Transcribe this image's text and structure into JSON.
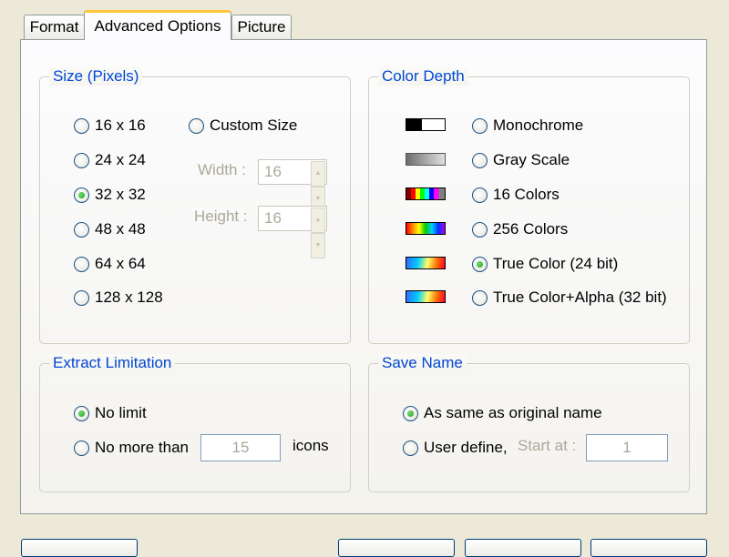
{
  "tabs": [
    {
      "label": "Format",
      "active": false
    },
    {
      "label": "Advanced Options",
      "active": true
    },
    {
      "label": "Picture",
      "active": false
    }
  ],
  "size_group": {
    "title": "Size (Pixels)",
    "options": [
      {
        "label": "16 x 16",
        "checked": false
      },
      {
        "label": "24 x 24",
        "checked": false
      },
      {
        "label": "32 x 32",
        "checked": true
      },
      {
        "label": "48 x 48",
        "checked": false
      },
      {
        "label": "64 x 64",
        "checked": false
      },
      {
        "label": "128 x 128",
        "checked": false
      }
    ],
    "custom": {
      "label": "Custom Size",
      "checked": false
    },
    "width": {
      "label": "Width :",
      "value": "16"
    },
    "height": {
      "label": "Height :",
      "value": "16"
    }
  },
  "color_group": {
    "title": "Color Depth",
    "options": [
      {
        "label": "Monochrome",
        "checked": false,
        "icon": "monochrome-swatch"
      },
      {
        "label": "Gray Scale",
        "checked": false,
        "icon": "grayscale-swatch"
      },
      {
        "label": "16 Colors",
        "checked": false,
        "icon": "16-colors-swatch"
      },
      {
        "label": "256 Colors",
        "checked": false,
        "icon": "256-colors-swatch"
      },
      {
        "label": "True Color (24 bit)",
        "checked": true,
        "icon": "true-color-swatch"
      },
      {
        "label": "True Color+Alpha (32 bit)",
        "checked": false,
        "icon": "true-color-alpha-swatch"
      }
    ]
  },
  "extract_group": {
    "title": "Extract Limitation",
    "no_limit": {
      "label": "No limit",
      "checked": true
    },
    "no_more_than": {
      "label": "No more than",
      "checked": false,
      "value": "15",
      "suffix": "icons"
    }
  },
  "save_group": {
    "title": "Save Name",
    "same": {
      "label": "As same as original name",
      "checked": true
    },
    "user": {
      "label": "User define,",
      "checked": false,
      "start_label": "Start at :",
      "start_value": "1"
    }
  },
  "colors": {
    "accent_title": "#0046D5",
    "tab_highlight": "#FFC83C",
    "radio_check": "#21A121",
    "disabled_text": "#ACA899"
  }
}
